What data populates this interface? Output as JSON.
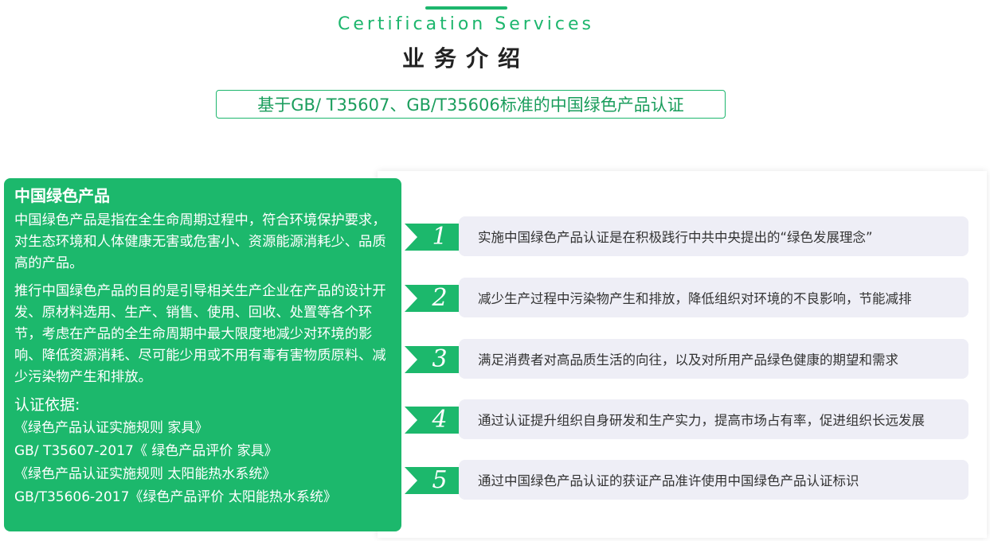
{
  "header": {
    "subtitle_en": "Certification Services",
    "title_cn": "业务介绍",
    "standard_label": "基于GB/ T35607、GB/T35606标准的中国绿色产品认证"
  },
  "card": {
    "heading": "中国绿色产品",
    "para1": "中国绿色产品是指在全生命周期过程中，符合环境保护要求，对生态环境和人体健康无害或危害小、资源能源消耗少、品质高的产品。",
    "para2": "推行中国绿色产品的目的是引导相关生产企业在产品的设计开发、原材料选用、生产、销售、使用、回收、处置等各个环节，考虑在产品的全生命周期中最大限度地减少对环境的影响、降低资源消耗、尽可能少用或不用有毒有害物质原料、减少污染物产生和排放。",
    "basis_heading": "认证依据:",
    "basis": [
      "《绿色产品认证实施规则 家具》",
      " GB/ T35607-2017《 绿色产品评价 家具》",
      "《绿色产品认证实施规则 太阳能热水系统》",
      "GB/T35606-2017《绿色产品评价 太阳能热水系统》"
    ]
  },
  "items": [
    {
      "number": "1",
      "text": "实施中国绿色产品认证是在积极践行中共中央提出的“绿色发展理念”"
    },
    {
      "number": "2",
      "text": "减少生产过程中污染物产生和排放，降低组织对环境的不良影响，节能减排"
    },
    {
      "number": "3",
      "text": "满足消费者对高品质生活的向往，以及对所用产品绿色健康的期望和需求"
    },
    {
      "number": "4",
      "text": "通过认证提升组织自身研发和生产实力，提高市场占有率，促进组织长远发展"
    },
    {
      "number": "5",
      "text": "通过中国绿色产品认证的获证产品准许使用中国绿色产品认证标识"
    }
  ],
  "colors": {
    "accent": "#1cb86c",
    "item_bg": "#eeeef6"
  }
}
